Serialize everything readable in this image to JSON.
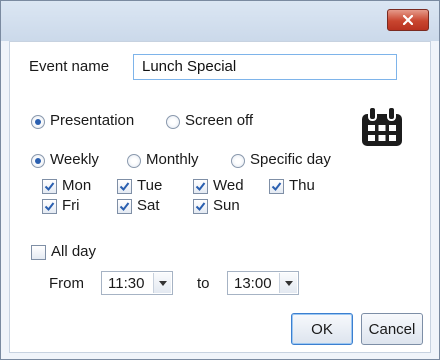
{
  "dialog": {
    "event_name_label": "Event name",
    "event_name_value": "Lunch Special",
    "mode": {
      "options": [
        "Presentation",
        "Screen off"
      ],
      "selected": "Presentation"
    },
    "recurrence": {
      "options": [
        "Weekly",
        "Monthly",
        "Specific day"
      ],
      "selected": "Weekly"
    },
    "days": [
      {
        "label": "Mon",
        "checked": true
      },
      {
        "label": "Tue",
        "checked": true
      },
      {
        "label": "Wed",
        "checked": true
      },
      {
        "label": "Thu",
        "checked": true
      },
      {
        "label": "Fri",
        "checked": true
      },
      {
        "label": "Sat",
        "checked": true
      },
      {
        "label": "Sun",
        "checked": true
      }
    ],
    "all_day": {
      "label": "All day",
      "checked": false
    },
    "time": {
      "from_label": "From",
      "from_value": "11:30",
      "to_label": "to",
      "to_value": "13:00"
    },
    "buttons": {
      "ok": "OK",
      "cancel": "Cancel"
    },
    "icons": {
      "close": "close-icon",
      "calendar": "calendar-icon"
    },
    "colors": {
      "accent": "#2a5fb0",
      "close_button": "#c9452f",
      "focus_border": "#7eb4ea"
    }
  }
}
